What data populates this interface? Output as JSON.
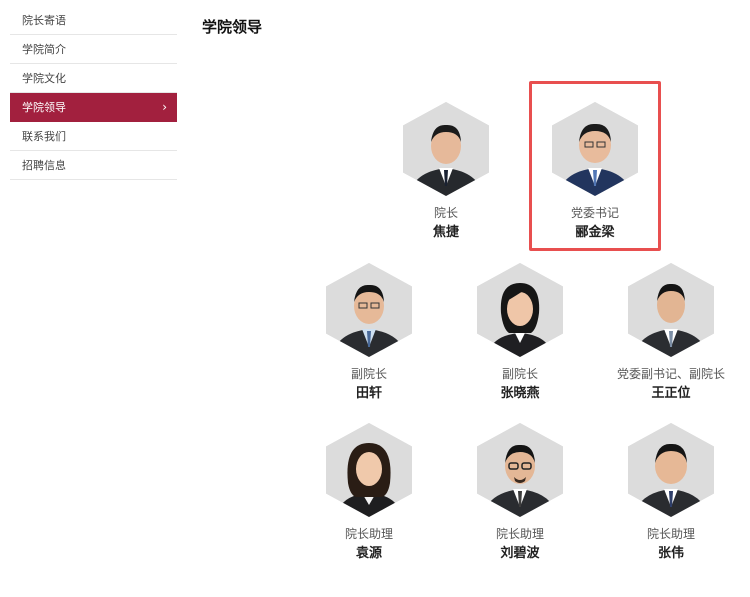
{
  "sidebar": {
    "items": [
      {
        "label": "院长寄语"
      },
      {
        "label": "学院简介"
      },
      {
        "label": "学院文化"
      },
      {
        "label": "学院领导",
        "active": true
      },
      {
        "label": "联系我们"
      },
      {
        "label": "招聘信息"
      }
    ],
    "chevron_icon": "chevron-right-icon"
  },
  "page": {
    "title": "学院领导"
  },
  "leaders": [
    {
      "role": "院长",
      "name": "焦捷"
    },
    {
      "role": "党委书记",
      "name": "郦金梁",
      "highlighted": true
    },
    {
      "role": "副院长",
      "name": "田轩"
    },
    {
      "role": "副院长",
      "name": "张晓燕"
    },
    {
      "role": "党委副书记、副院长",
      "name": "王正位"
    },
    {
      "role": "院长助理",
      "name": "袁源"
    },
    {
      "role": "院长助理",
      "name": "刘碧波"
    },
    {
      "role": "院长助理",
      "name": "张伟"
    }
  ],
  "colors": {
    "accent": "#a2203e",
    "highlight_border": "#e84f4f",
    "hex_background": "#dcdcdc"
  }
}
